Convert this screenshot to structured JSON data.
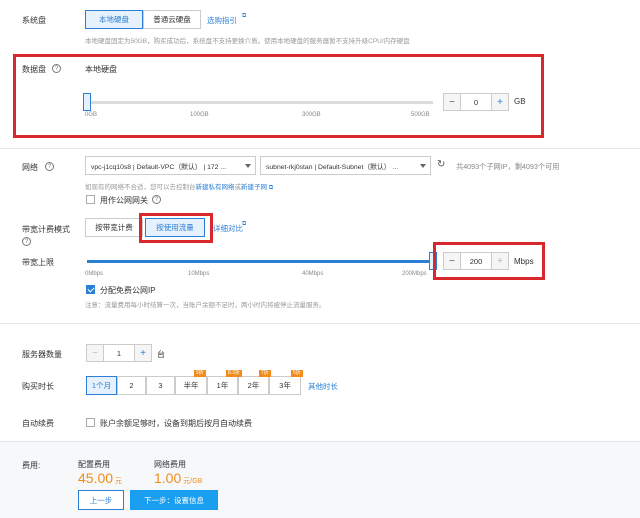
{
  "system_disk": {
    "label": "系统盘",
    "options": [
      "本地硬盘",
      "普通云硬盘"
    ],
    "help_link": "选购指引",
    "note": "本地硬盘固定为50GB，购买成功后，系统盘不支持更换介质。使用本地硬盘的服务器暂不支持升级CPU/内存硬盘"
  },
  "data_disk": {
    "label": "数据盘",
    "type_label": "本地硬盘",
    "slider_ticks": [
      "0GB",
      "100GB",
      "300GB",
      "500GB"
    ],
    "value": "0",
    "unit": "GB",
    "fill_fraction": 0
  },
  "network": {
    "label": "网络",
    "vpc_value": "vpc-j1cq10s8 | Default-VPC（默认） | 172 ...",
    "subnet_value": "subnet-rkj0stan | Default-Subnet（默认） ...",
    "subnet_info": "共4093个子网IP，剩4093个可用",
    "note_prefix": "如现有的网络不合适，您可以去控制台",
    "new_vpc_link": "新建私有网络",
    "or_text": "或",
    "new_subnet_link": "新建子网",
    "gateway_label": "用作公网网关"
  },
  "bandwidth_mode": {
    "label": "带宽计费模式",
    "options": [
      "按带宽计费",
      "按使用流量"
    ],
    "compare_link": "详细对比"
  },
  "bandwidth_cap": {
    "label": "带宽上限",
    "slider_ticks": [
      "0Mbps",
      "10Mbps",
      "40Mbps",
      "200Mbps"
    ],
    "value": "200",
    "unit": "Mbps",
    "fill_fraction": 1,
    "free_ip_label": "分配免费公网IP",
    "note": "注意：流量费用每小时结算一次，当账户余额不足时，两小时内将被停止流量服务。"
  },
  "server_count": {
    "label": "服务器数量",
    "value": "1",
    "unit": "台"
  },
  "purchase_duration": {
    "label": "购买时长",
    "options": [
      {
        "label": "1个月",
        "badge": ""
      },
      {
        "label": "2",
        "badge": ""
      },
      {
        "label": "3",
        "badge": ""
      },
      {
        "label": "半年",
        "badge": "9折"
      },
      {
        "label": "1年",
        "badge": "8.3折"
      },
      {
        "label": "2年",
        "badge": "7折"
      },
      {
        "label": "3年",
        "badge": "5折"
      }
    ],
    "other_link": "其他时长"
  },
  "auto_renew": {
    "label": "自动续费",
    "text": "账户余额足够时，设备到期后按月自动续费"
  },
  "footer": {
    "fee_label": "费用:",
    "config_fee_label": "配置费用",
    "config_fee_value": "45.00",
    "config_fee_unit": "元",
    "net_fee_label": "网络费用",
    "net_fee_value": "1.00",
    "net_fee_unit": "元/GB",
    "prev_button": "上一步",
    "next_button": "下一步：设置信息"
  },
  "colors": {
    "accent": "#2b7fd6",
    "highlight": "#d9272e",
    "price": "#f08c1a"
  }
}
